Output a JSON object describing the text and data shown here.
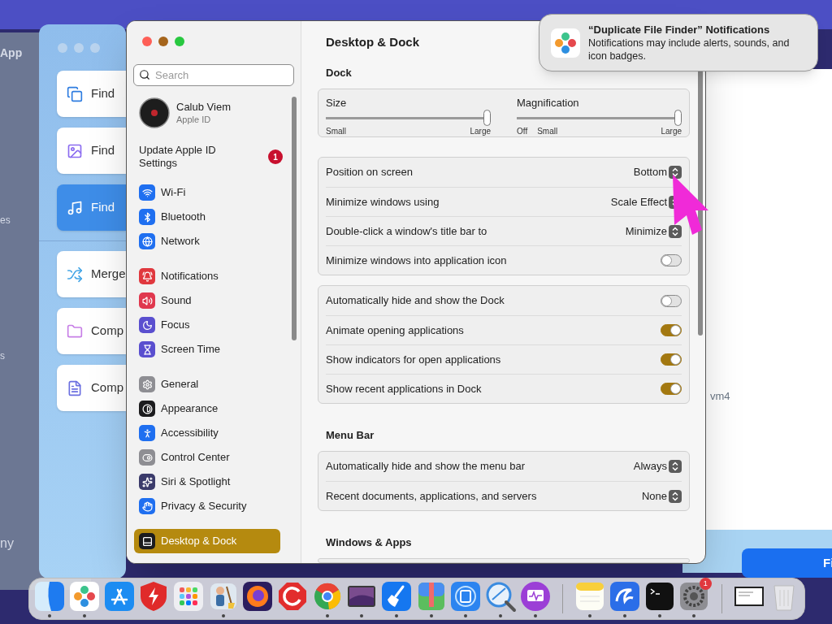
{
  "desktop": {
    "back_window": {
      "texts": [
        "App",
        "es",
        "s",
        "ny"
      ]
    },
    "app_window": {
      "cards": [
        {
          "label": "Find",
          "selected": false
        },
        {
          "label": "Find",
          "selected": false
        },
        {
          "label": "Find",
          "selected": true
        },
        {
          "label": "Merge",
          "selected": false
        },
        {
          "label": "Comp",
          "selected": false
        },
        {
          "label": "Comp",
          "selected": false
        }
      ]
    },
    "right_window": {
      "text": "vm4",
      "button": "Fi"
    }
  },
  "settings": {
    "sidebar": {
      "search": {
        "placeholder": "Search"
      },
      "account": {
        "name": "Calub Viem",
        "subtitle": "Apple ID"
      },
      "update": {
        "label": "Update Apple ID Settings",
        "badge": "1"
      },
      "groups": [
        {
          "items": [
            {
              "label": "Wi-Fi",
              "color": "#1f6ff0",
              "selected": false
            },
            {
              "label": "Bluetooth",
              "color": "#1f6ff0",
              "selected": false
            },
            {
              "label": "Network",
              "color": "#1f6ff0",
              "selected": false
            }
          ]
        },
        {
          "items": [
            {
              "label": "Notifications",
              "color": "#e0383e",
              "selected": false
            },
            {
              "label": "Sound",
              "color": "#e0384e",
              "selected": false
            },
            {
              "label": "Focus",
              "color": "#5a4fcf",
              "selected": false
            },
            {
              "label": "Screen Time",
              "color": "#5a4fcf",
              "selected": false
            }
          ]
        },
        {
          "items": [
            {
              "label": "General",
              "color": "#8e8e93",
              "selected": false
            },
            {
              "label": "Appearance",
              "color": "#1c1c1e",
              "selected": false
            },
            {
              "label": "Accessibility",
              "color": "#1f6ff0",
              "selected": false
            },
            {
              "label": "Control Center",
              "color": "#8e8e93",
              "selected": false
            },
            {
              "label": "Siri & Spotlight",
              "color": "#3b3b6b",
              "selected": false
            },
            {
              "label": "Privacy & Security",
              "color": "#1f6ff0",
              "selected": false
            }
          ]
        },
        {
          "items": [
            {
              "label": "Desktop & Dock",
              "color": "#1c1c1e",
              "selected": true
            }
          ]
        }
      ]
    },
    "title": "Desktop & Dock",
    "sections": [
      {
        "heading": "Dock",
        "cards": [
          {
            "kind": "sliders",
            "sliders": [
              {
                "label": "Size",
                "level": 1,
                "marks": [
                  "Small",
                  "Large"
                ]
              },
              {
                "label": "Magnification",
                "level": 1,
                "marks": [
                  "Off",
                  "Small",
                  "Large"
                ]
              }
            ]
          },
          {
            "kind": "rows",
            "rows": [
              {
                "kind": "select",
                "label": "Position on screen",
                "value": "Bottom"
              },
              {
                "kind": "select",
                "label": "Minimize windows using",
                "value": "Scale Effect"
              },
              {
                "kind": "select",
                "label": "Double-click a window's title bar to",
                "value": "Minimize"
              },
              {
                "kind": "toggle",
                "label": "Minimize windows into application icon",
                "on": false
              }
            ]
          },
          {
            "kind": "rows",
            "rows": [
              {
                "kind": "toggle",
                "label": "Automatically hide and show the Dock",
                "on": false
              },
              {
                "kind": "toggle",
                "label": "Animate opening applications",
                "on": true
              },
              {
                "kind": "toggle",
                "label": "Show indicators for open applications",
                "on": true
              },
              {
                "kind": "toggle",
                "label": "Show recent applications in Dock",
                "on": true
              }
            ]
          }
        ]
      },
      {
        "heading": "Menu Bar",
        "cards": [
          {
            "kind": "rows",
            "rows": [
              {
                "kind": "select",
                "label": "Automatically hide and show the menu bar",
                "value": "Always"
              },
              {
                "kind": "select",
                "label": "Recent documents, applications, and servers",
                "value": "None"
              }
            ]
          }
        ]
      },
      {
        "heading": "Windows & Apps",
        "cards": [
          {
            "kind": "rows"
          }
        ]
      }
    ]
  },
  "notification": {
    "title": "“Duplicate File Finder” Notifications",
    "body": "Notifications may include alerts, sounds, and icon badges."
  },
  "dock": {
    "items": [
      {
        "running": true
      },
      {
        "running": true
      },
      {
        "running": false
      },
      {
        "running": false
      },
      {
        "running": false
      },
      {
        "running": true
      },
      {
        "running": false
      },
      {
        "running": false
      },
      {
        "running": true
      },
      {
        "running": true
      },
      {
        "running": true
      },
      {
        "running": true
      },
      {
        "running": true
      },
      {
        "running": true
      },
      {
        "running": true
      },
      {
        "running": true
      },
      {
        "running": true
      },
      {
        "running": true
      },
      {
        "running": true,
        "badge": "1"
      },
      {
        "running": false
      },
      {
        "running": false
      }
    ]
  }
}
